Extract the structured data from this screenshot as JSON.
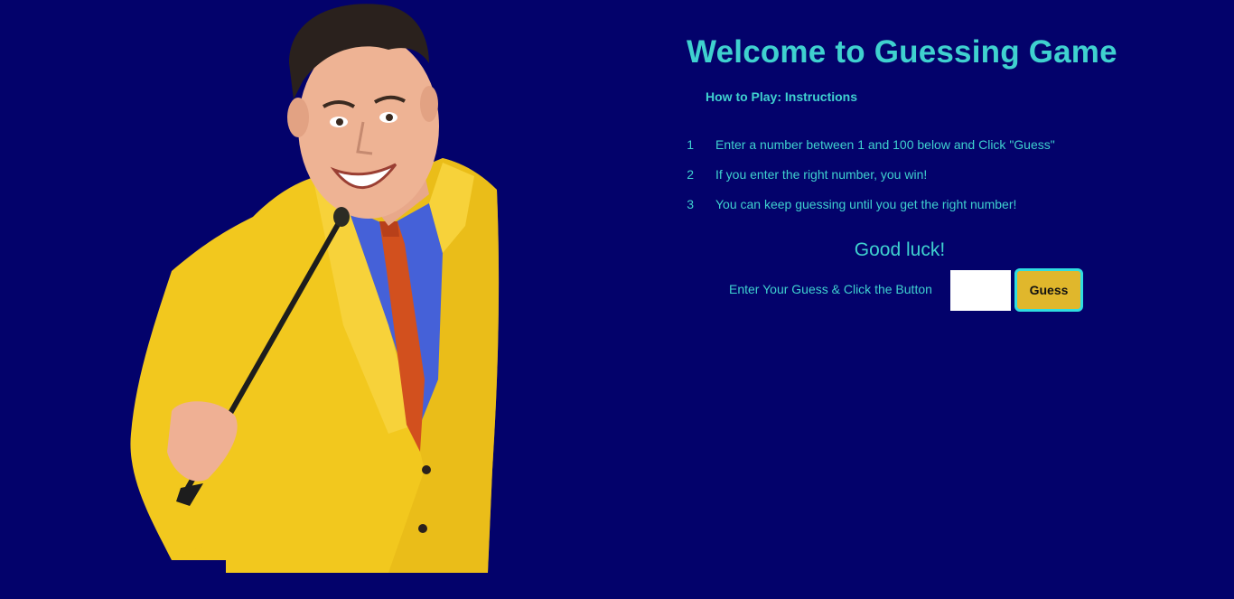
{
  "header": {
    "title": "Welcome to Guessing Game",
    "subtitle": "How to Play: Instructions"
  },
  "instructions": [
    {
      "number": "1",
      "text": "Enter a number between 1 and 100 below and Click \"Guess\""
    },
    {
      "number": "2",
      "text": "If you enter the right number, you win!"
    },
    {
      "number": "3",
      "text": "You can keep guessing until you get the right number!"
    }
  ],
  "good_luck": "Good luck!",
  "guess_form": {
    "label": "Enter Your Guess & Click the Button",
    "input_value": "",
    "button_label": "Guess"
  },
  "colors": {
    "background": "#03026b",
    "accent_text": "#3fd1cf",
    "button_fill": "#e0b72c",
    "button_border": "#2fdde0"
  },
  "image": {
    "description_icon": "game-show-host-image"
  }
}
